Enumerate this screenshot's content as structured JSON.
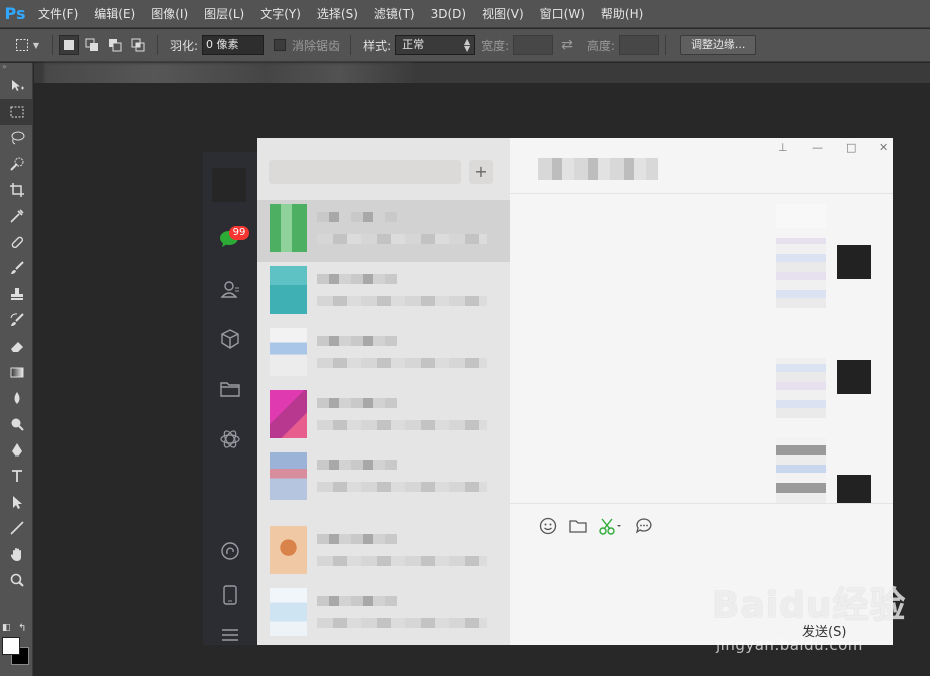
{
  "app": {
    "logo": "Ps"
  },
  "menu": [
    "文件(F)",
    "编辑(E)",
    "图像(I)",
    "图层(L)",
    "文字(Y)",
    "选择(S)",
    "滤镜(T)",
    "3D(D)",
    "视图(V)",
    "窗口(W)",
    "帮助(H)"
  ],
  "options": {
    "feather_label": "羽化:",
    "feather_value": "0 像素",
    "antialias_label": "消除锯齿",
    "style_label": "样式:",
    "style_value": "正常",
    "width_label": "宽度:",
    "height_label": "高度:",
    "refine_edge": "调整边缘..."
  },
  "tools": [
    "move-tool",
    "marquee-tool",
    "lasso-tool",
    "quick-select-tool",
    "crop-tool",
    "eyedropper-tool",
    "healing-brush-tool",
    "brush-tool",
    "clone-stamp-tool",
    "history-brush-tool",
    "eraser-tool",
    "gradient-tool",
    "blur-tool",
    "dodge-tool",
    "pen-tool",
    "type-tool",
    "path-select-tool",
    "line-tool",
    "hand-tool",
    "zoom-tool"
  ],
  "colors": {
    "foreground": "#ffffff",
    "background": "#000000",
    "accent": "#31a8ff"
  },
  "wechat": {
    "badge": "99",
    "add_button": "+",
    "send_button": "发送(S)"
  },
  "watermark": {
    "main": "Baidu经验",
    "sub": "jingyan.baidu.com"
  }
}
